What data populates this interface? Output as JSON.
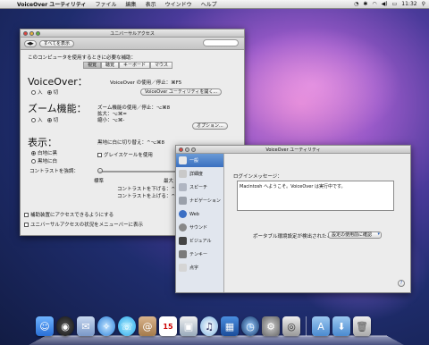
{
  "menubar": {
    "apple_icon": "apple-icon",
    "app_name": "VoiceOver ユーティリティ",
    "items": [
      "ファイル",
      "編集",
      "表示",
      "ウインドウ",
      "ヘルプ"
    ],
    "clock": "11:32"
  },
  "ua_window": {
    "title": "ユニバーサルアクセス",
    "show_all": "すべてを表示",
    "intro": "このコンピュータを使用するときに必要な補助：",
    "tabs": [
      "視覚",
      "聴覚",
      "キーボード",
      "マウス"
    ],
    "voiceover": {
      "heading": "VoiceOver：",
      "toggle_label": "VoiceOver の使用／停止：⌘F5",
      "on": "入",
      "off": "切",
      "open_button": "VoiceOver ユーティリティを開く..."
    },
    "zoom": {
      "heading": "ズーム機能：",
      "toggle_label": "ズーム機能の使用／停止：⌥⌘8",
      "zoom_in": "拡大：⌥⌘=",
      "zoom_out": "縮小：⌥⌘-",
      "on": "入",
      "off": "切",
      "options_button": "オプション..."
    },
    "display": {
      "heading": "表示：",
      "invert_label": "黒地に白に切り替え：^⌥⌘8",
      "white_on_black": "白地に黒",
      "black_on_white": "黒地に白",
      "grayscale": "グレイスケールを使用",
      "contrast_label": "コントラストを強調：",
      "normal": "標準",
      "maximum": "最大",
      "contrast_up": "コントラストを下げる：^⌥⌘,",
      "contrast_down": "コントラストを上げる：^⌥⌘."
    },
    "assistive_devices": "補助装置にアクセスできるようにする",
    "menu_status": "ユニバーサルアクセスの状況をメニューバーに表示"
  },
  "vo_window": {
    "title": "VoiceOver ユーティリティ",
    "sidebar": [
      "一般",
      "詳細度",
      "スピーチ",
      "ナビゲーション",
      "Web",
      "サウンド",
      "ビジュアル",
      "テンキー",
      "点字"
    ],
    "login_label": "ログインメッセージ：",
    "login_message": "Macintosh へようこそ。VoiceOver は実行中です。",
    "portable_label": "ポータブル環境設定が検出されたとき：",
    "portable_value": "設定の使用前に確認",
    "help": "?"
  },
  "colors": {
    "selection": "#3a70c0",
    "desktop": "#4a3a9a"
  },
  "dock_icons": [
    "finder-icon",
    "dashboard-icon",
    "mail-icon",
    "safari-icon",
    "ichat-icon",
    "address-book-icon",
    "ical-icon",
    "preview-icon",
    "itunes-icon",
    "spaces-icon",
    "time-machine-icon",
    "system-preferences-icon",
    "voiceover-utility-icon",
    "applications-folder-icon",
    "downloads-folder-icon",
    "trash-icon"
  ],
  "dock_ical_day": "15"
}
